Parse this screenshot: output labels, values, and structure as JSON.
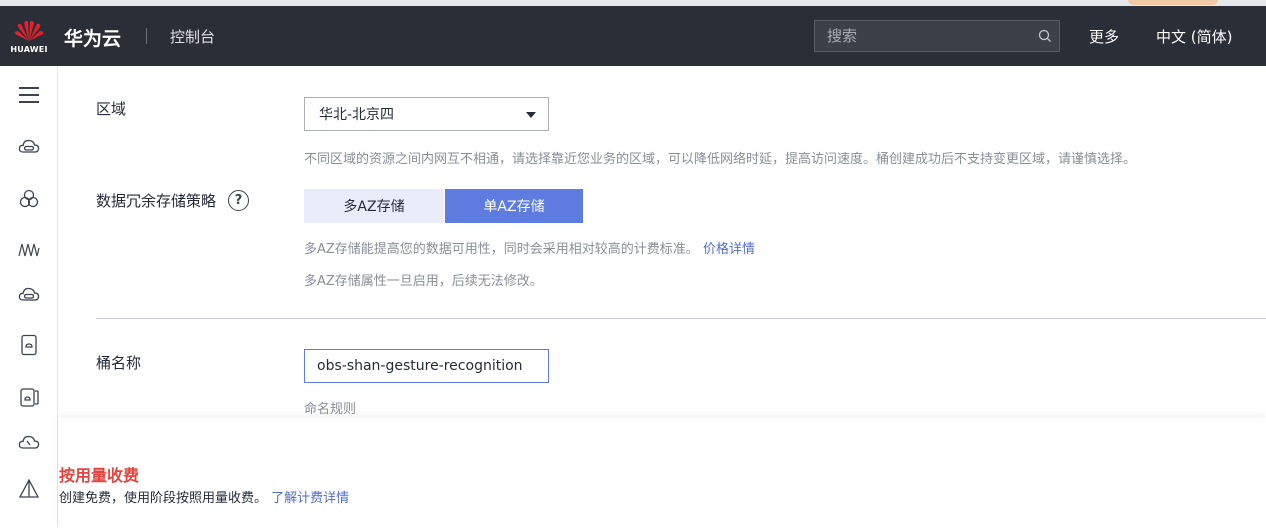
{
  "header": {
    "logo_text": "HUAWEI",
    "brand": "华为云",
    "console": "控制台",
    "search_placeholder": "搜索",
    "more": "更多",
    "language": "中文 (简体)"
  },
  "sidebar": {
    "items": [
      {
        "icon": "menu-icon"
      },
      {
        "icon": "cloud-storage-icon"
      },
      {
        "icon": "cluster-icon"
      },
      {
        "icon": "waveform-icon"
      },
      {
        "icon": "cloud-storage-icon"
      },
      {
        "icon": "device-icon"
      },
      {
        "icon": "devices-icon"
      },
      {
        "icon": "cloud-speed-icon"
      },
      {
        "icon": "tent-icon"
      }
    ]
  },
  "form": {
    "region": {
      "label": "区域",
      "value": "华北-北京四",
      "hint": "不同区域的资源之间内网互不相通，请选择靠近您业务的区域，可以降低网络时延，提高访问速度。桶创建成功后不支持变更区域，请谨慎选择。"
    },
    "redundancy": {
      "label": "数据冗余存储策略",
      "help": "?",
      "options": [
        "多AZ存储",
        "单AZ存储"
      ],
      "selected": "单AZ存储",
      "hint1": "多AZ存储能提高您的数据可用性，同时会采用相对较高的计费标准。",
      "hint1_link": "价格详情",
      "hint2": "多AZ存储属性一旦启用，后续无法修改。"
    },
    "bucket_name": {
      "label": "桶名称",
      "value": "obs-shan-gesture-recognition",
      "rule": "命名规则"
    }
  },
  "billing": {
    "title": "按用量收费",
    "desc": "创建免费，使用阶段按照用量收费。",
    "link": "了解计费详情"
  },
  "colors": {
    "topbar": "#2a2e36",
    "accent": "#5e7ce0",
    "link": "#526ecc",
    "billing_title": "#e3443f"
  }
}
